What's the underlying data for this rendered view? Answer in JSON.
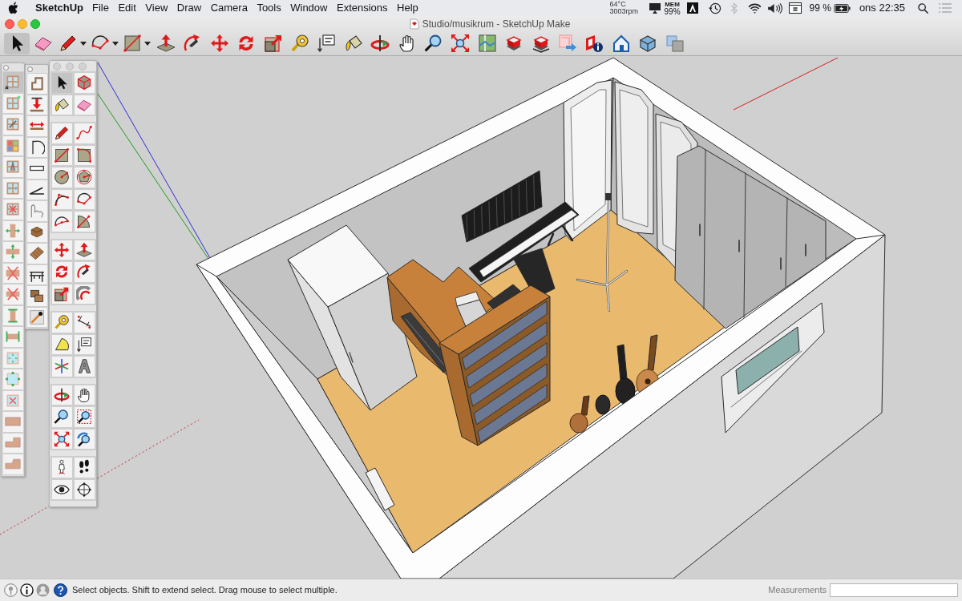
{
  "menu_bar": {
    "app_name": "SketchUp",
    "menus": [
      "File",
      "Edit",
      "View",
      "Draw",
      "Camera",
      "Tools",
      "Window",
      "Extensions",
      "Help"
    ],
    "temperature": "64°C",
    "fan_speed": "3003rpm",
    "memory_label": "MEM",
    "memory": "99%",
    "bluetooth": {
      "on": false
    },
    "battery": "99 %",
    "clock": "ons 22:35"
  },
  "window": {
    "title": "Studio/musikrum - SketchUp Make"
  },
  "toolbar": {
    "tools": [
      {
        "selected": true
      },
      {
        "selected": false
      },
      {
        "selected": false
      },
      {
        "selected": false
      },
      {
        "selected": false
      },
      {
        "selected": false
      },
      {
        "selected": false
      },
      {
        "selected": false
      },
      {
        "selected": false
      },
      {
        "selected": false
      },
      {
        "selected": false
      },
      {
        "selected": false
      },
      {
        "selected": false
      },
      {
        "selected": false
      },
      {
        "selected": false
      },
      {
        "selected": false
      },
      {
        "selected": false
      },
      {
        "selected": false
      },
      {
        "selected": false
      },
      {
        "selected": false
      },
      {
        "selected": false
      },
      {
        "selected": false
      },
      {
        "selected": false
      },
      {
        "selected": false
      },
      {
        "selected": false
      }
    ]
  },
  "tool_palettes": [
    {
      "tools": [
        {
          "selected": true
        },
        {
          "selected": false
        },
        {
          "selected": false
        },
        {
          "selected": false
        },
        {
          "selected": false
        },
        {
          "selected": false
        },
        {
          "selected": false
        },
        {
          "selected": false
        },
        {
          "selected": false
        },
        {
          "selected": false
        },
        {
          "selected": false
        },
        {
          "selected": false
        },
        {
          "selected": false
        },
        {
          "selected": false
        },
        {
          "selected": false
        },
        {
          "selected": false
        },
        {
          "selected": false
        },
        {
          "selected": false
        },
        {
          "selected": false
        }
      ]
    },
    {
      "tools": [
        {
          "selected": false
        },
        {
          "selected": false
        },
        {
          "selected": false
        },
        {
          "selected": false
        },
        {
          "selected": false
        },
        {
          "selected": false
        },
        {
          "selected": false
        },
        {
          "selected": false
        },
        {
          "selected": false
        },
        {
          "selected": false
        },
        {
          "selected": false
        },
        {
          "selected": false
        }
      ]
    },
    {
      "groups": [
        {
          "tools": [
            {
              "selected": true
            },
            {
              "selected": false
            },
            {
              "selected": false
            },
            {
              "selected": false
            }
          ]
        },
        {
          "tools": [
            {
              "selected": false
            },
            {
              "selected": false
            },
            {
              "selected": false
            },
            {
              "selected": false
            },
            {
              "selected": false
            },
            {
              "selected": false
            },
            {
              "selected": false
            },
            {
              "selected": false
            },
            {
              "selected": false
            },
            {
              "selected": false
            }
          ]
        },
        {
          "tools": [
            {
              "selected": false
            },
            {
              "selected": false
            },
            {
              "selected": false
            },
            {
              "selected": false
            },
            {
              "selected": false
            },
            {
              "selected": false
            }
          ]
        },
        {
          "tools": [
            {
              "selected": false
            },
            {
              "selected": false
            },
            {
              "selected": false
            },
            {
              "selected": false
            },
            {
              "selected": false
            },
            {
              "selected": false
            }
          ]
        },
        {
          "tools": [
            {
              "selected": false
            },
            {
              "selected": false
            },
            {
              "selected": false
            },
            {
              "selected": false
            },
            {
              "selected": false
            },
            {
              "selected": false
            }
          ]
        },
        {
          "tools": [
            {
              "selected": false
            },
            {
              "selected": false
            },
            {
              "selected": false
            },
            {
              "selected": false
            }
          ]
        }
      ]
    }
  ],
  "status_bar": {
    "hint": "Select objects. Shift to extend select. Drag mouse to select multiple.",
    "measurements_label": "Measurements"
  }
}
